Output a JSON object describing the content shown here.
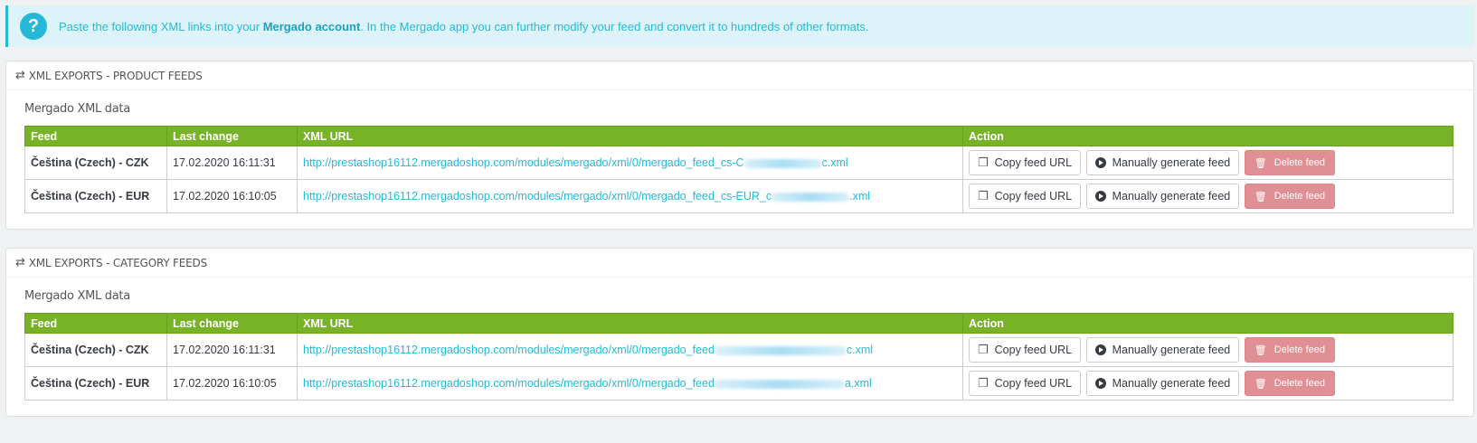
{
  "info": {
    "icon": "?",
    "text_before": "Paste the following XML links into your ",
    "link": "Mergado account",
    "text_after": ". In the Mergado app you can further modify your feed and convert it to hundreds of other formats."
  },
  "headers": [
    "Feed",
    "Last change",
    "XML URL",
    "Action"
  ],
  "buttons": {
    "copy": "Copy feed URL",
    "generate": "Manually generate feed",
    "delete": "Delete feed"
  },
  "product_panel": {
    "title": "XML EXPORTS - PRODUCT FEEDS",
    "subtitle": "Mergado XML data",
    "rows": [
      {
        "feed": "Čeština (Czech) - CZK",
        "last_change": "17.02.2020 16:11:31",
        "url_a": "http://prestashop16112.mergadoshop.com/modules/mergado/xml/0/mergado_feed_cs-C",
        "url_b": "c.xml"
      },
      {
        "feed": "Čeština (Czech) - EUR",
        "last_change": "17.02.2020 16:10:05",
        "url_a": "http://prestashop16112.mergadoshop.com/modules/mergado/xml/0/mergado_feed_cs-EUR_c",
        "url_b": ".xml"
      }
    ]
  },
  "category_panel": {
    "title": "XML EXPORTS - CATEGORY FEEDS",
    "subtitle": "Mergado XML data",
    "rows": [
      {
        "feed": "Čeština (Czech) - CZK",
        "last_change": "17.02.2020 16:11:31",
        "url_a": "http://prestashop16112.mergadoshop.com/modules/mergado/xml/0/mergado_feed",
        "url_b": "c.xml"
      },
      {
        "feed": "Čeština (Czech) - EUR",
        "last_change": "17.02.2020 16:10:05",
        "url_a": "http://prestashop16112.mergadoshop.com/modules/mergado/xml/0/mergado_feed",
        "url_b": "a.xml"
      }
    ]
  }
}
